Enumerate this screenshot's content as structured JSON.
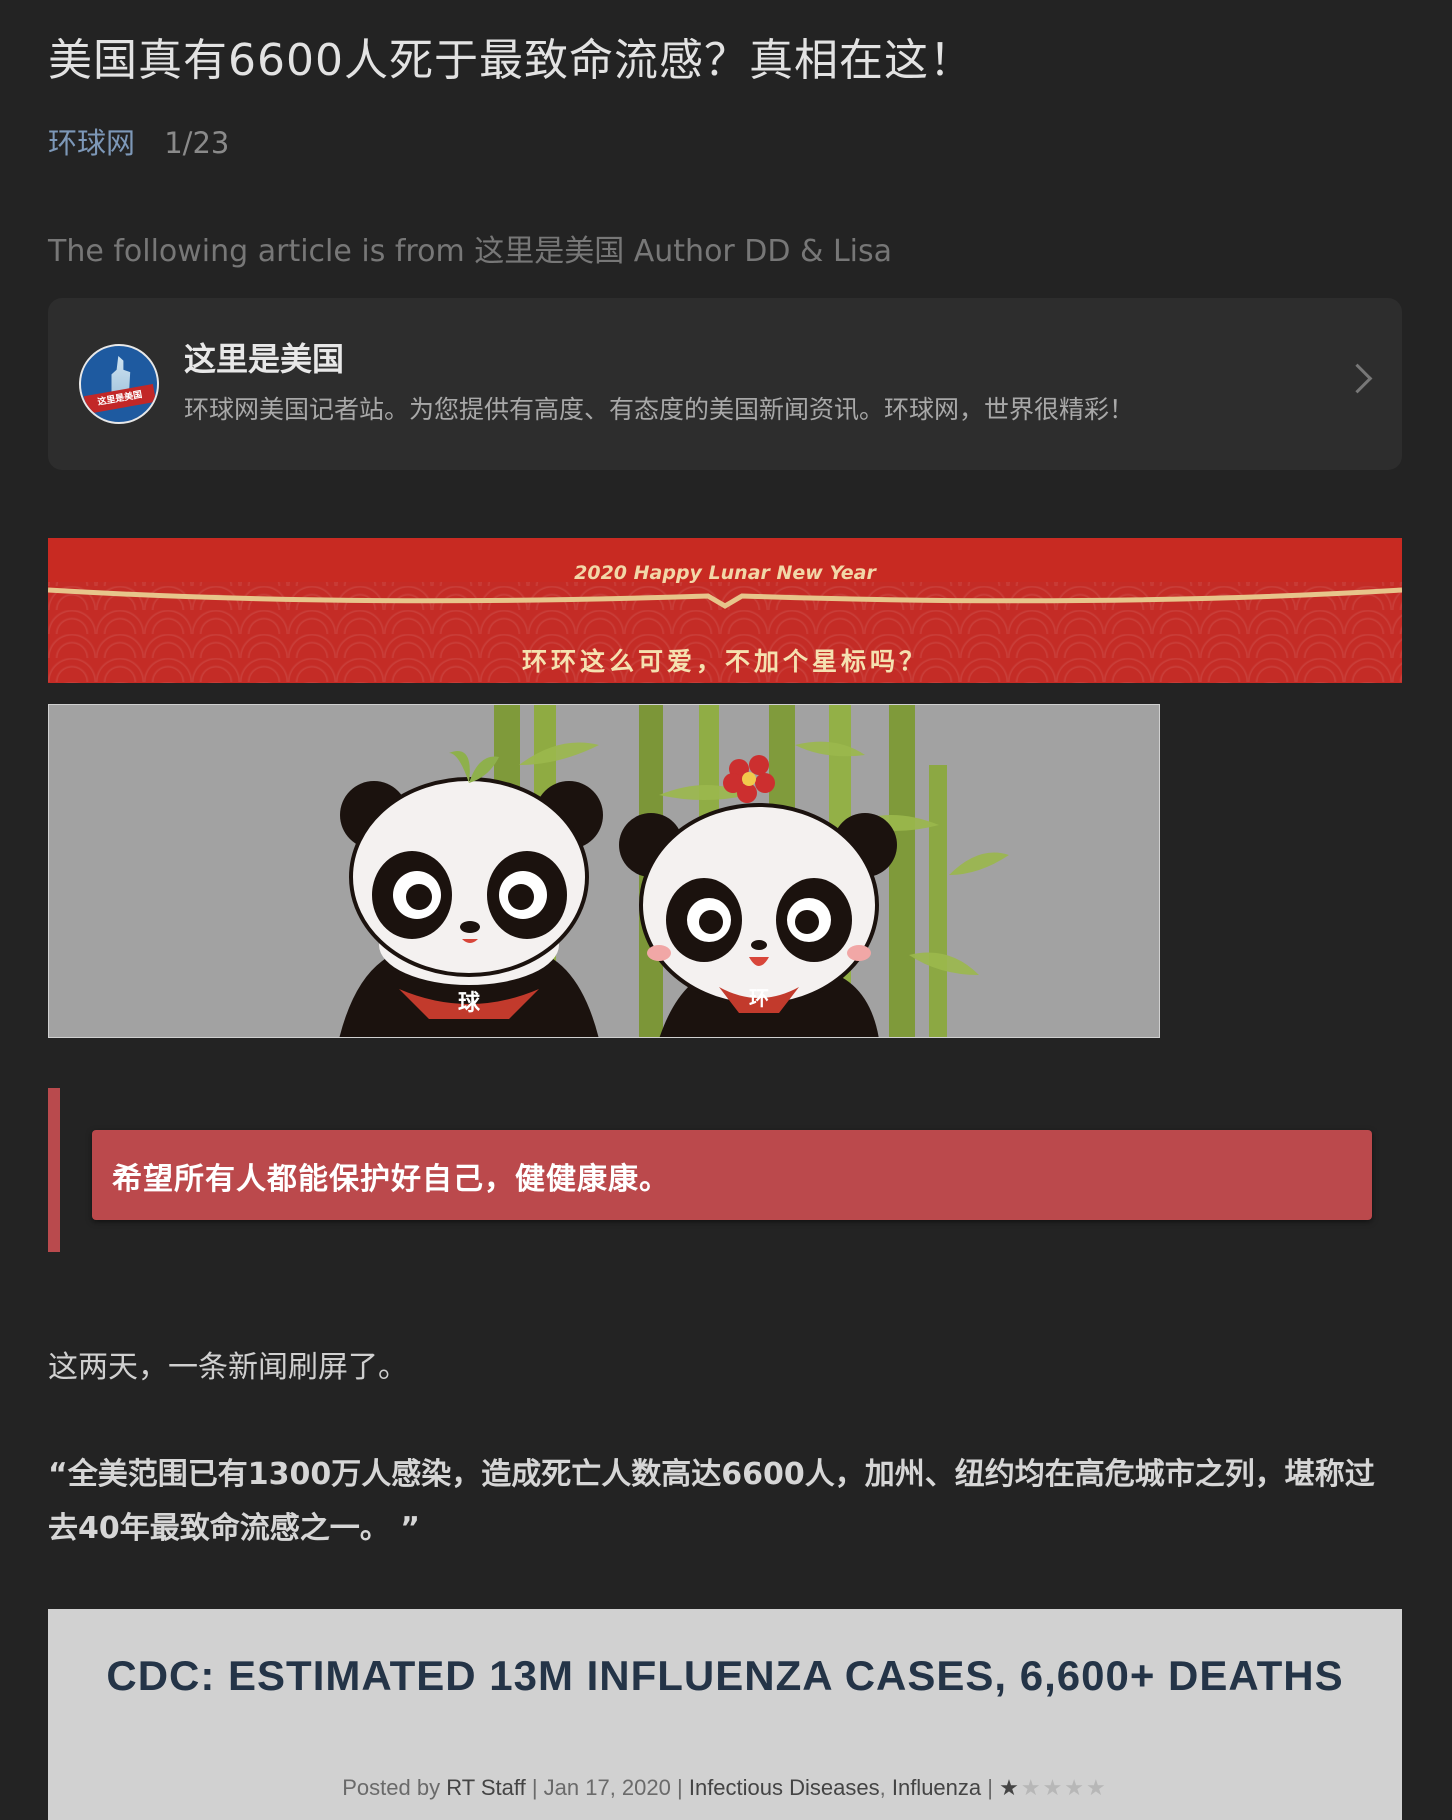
{
  "article": {
    "title": "美国真有6600人死于最致命流感？真相在这！",
    "source": "环球网",
    "date": "1/23",
    "from_line": "The following article is from 这里是美国 Author DD & Lisa"
  },
  "profile_card": {
    "name": "这里是美国",
    "description": "环球网美国记者站。为您提供有高度、有态度的美国新闻资讯。环球网，世界很精彩！",
    "avatar_text": "这里是美国"
  },
  "banner": {
    "year_text": "2020 Happy Lunar New Year",
    "prompt": "环环这么可爱，不加个星标吗？"
  },
  "panda_image": {
    "left_bib": "球",
    "right_bib": "环"
  },
  "quote": {
    "text": "希望所有人都能保护好自己，健健康康。"
  },
  "body": {
    "para1": "这两天，一条新闻刷屏了。",
    "para2": "“全美范围已有1300万人感染，造成死亡人数高达6600人，加州、纽约均在高危城市之列，堪称过去40年最致命流感之一。 ”"
  },
  "news_image": {
    "headline": "CDC: ESTIMATED 13M INFLUENZA CASES, 6,600+ DEATHS",
    "posted_by_label": "Posted by",
    "author": "RT Staff",
    "date": "Jan 17, 2020",
    "category1": "Infectious Diseases",
    "category2": "Influenza",
    "rating": 1,
    "rating_max": 5
  },
  "colors": {
    "background": "#232323",
    "accent_red": "#bb494c",
    "source_link": "#7d98b8"
  }
}
